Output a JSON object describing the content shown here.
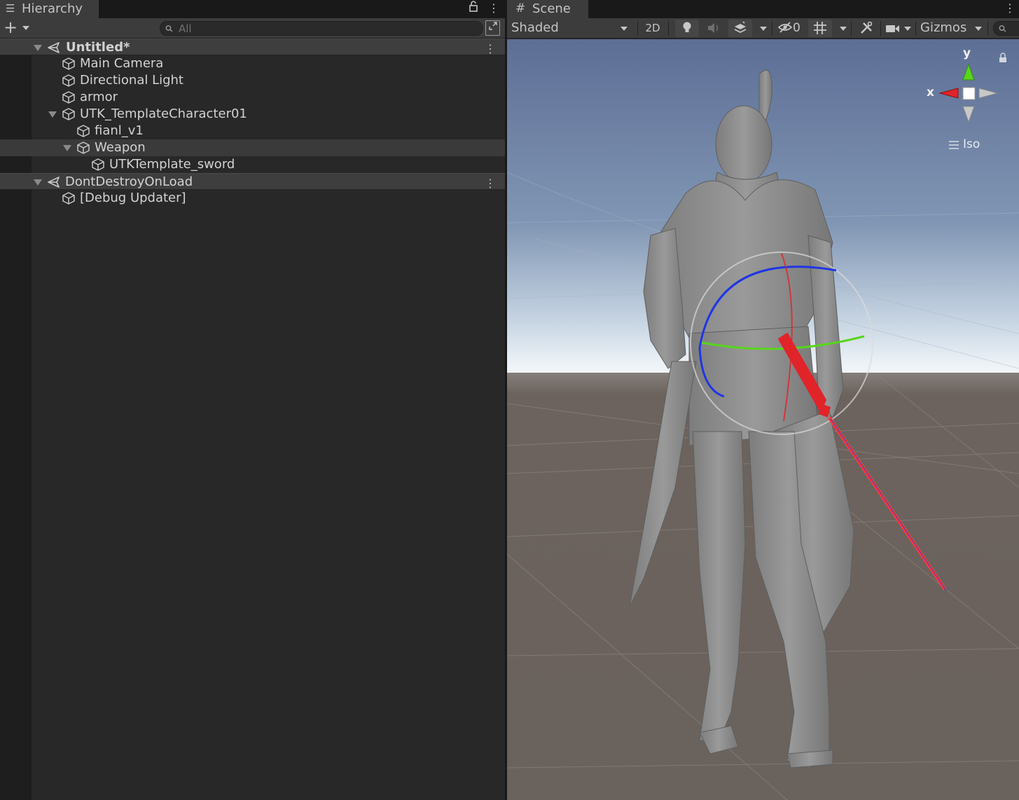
{
  "hierarchy": {
    "tab_title": "Hierarchy",
    "tab_icon": "list-icon",
    "search": {
      "placeholder": "All",
      "value": ""
    },
    "rows": [
      {
        "label": "Untitled*",
        "type": "scene"
      },
      {
        "label": "Main Camera",
        "type": "gameobject"
      },
      {
        "label": "Directional Light",
        "type": "gameobject"
      },
      {
        "label": "armor",
        "type": "gameobject"
      },
      {
        "label": "UTK_TemplateCharacter01",
        "type": "gameobject"
      },
      {
        "label": "fianl_v1",
        "type": "gameobject"
      },
      {
        "label": "Weapon",
        "type": "gameobject",
        "selected": true
      },
      {
        "label": "UTKTemplate_sword",
        "type": "gameobject"
      },
      {
        "label": "DontDestroyOnLoad",
        "type": "scene"
      },
      {
        "label": "[Debug Updater]",
        "type": "gameobject"
      }
    ]
  },
  "scene": {
    "tab_title": "Scene",
    "tab_icon": "grid-hash-icon",
    "shading_mode": "Shaded",
    "toggle_2d": "2D",
    "hidden_count": "0",
    "gizmos_label": "Gizmos",
    "orientation": {
      "y_label": "y",
      "x_label": "x",
      "projection_label": "Iso"
    }
  },
  "colors": {
    "panel_bg": "#282828",
    "toolbar_bg": "#3c3c3c",
    "sky_top": "#5f7096",
    "horizon": "#e6edf3",
    "ground": "#6b625d",
    "gizmo_red": "#e0242a",
    "gizmo_green": "#58d61d",
    "gizmo_blue": "#2035e6"
  }
}
